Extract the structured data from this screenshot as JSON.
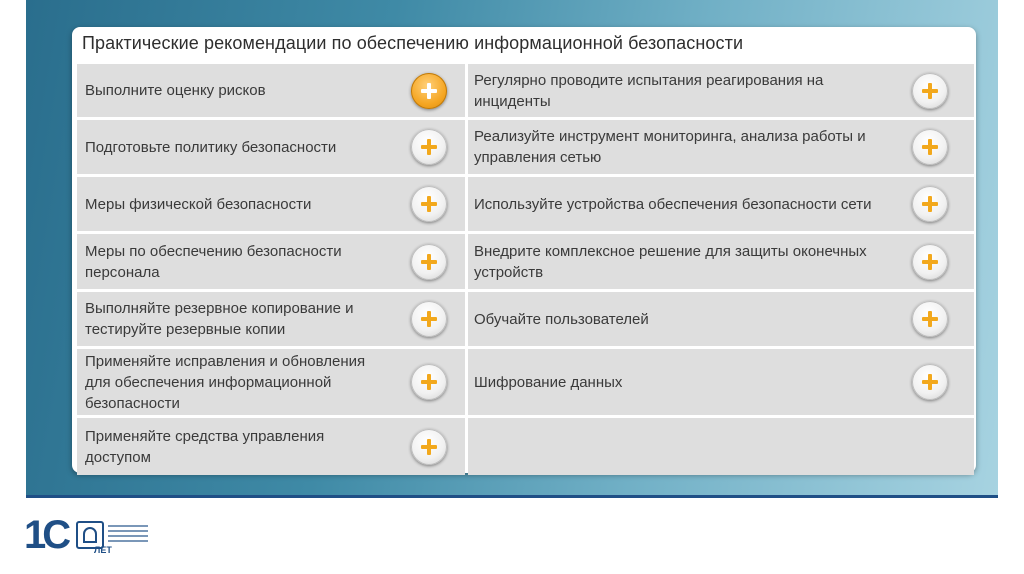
{
  "title": "Практические рекомендации по обеспечению информационной безопасности",
  "left_items": [
    {
      "label": "Выполните оценку рисков",
      "active": true
    },
    {
      "label": "Подготовьте политику безопасности",
      "active": false
    },
    {
      "label": "Меры физической безопасности",
      "active": false
    },
    {
      "label": "Меры по обеспечению безопасности персонала",
      "active": false
    },
    {
      "label": "Выполняйте резервное копирование и тестируйте резервные копии",
      "active": false
    },
    {
      "label": "Применяйте исправления и обновления для обеспечения информационной безопасности",
      "active": false
    },
    {
      "label": "Применяйте средства управления доступом",
      "active": false
    }
  ],
  "right_items": [
    {
      "label": "Регулярно проводите испытания реагирования на инциденты",
      "active": false
    },
    {
      "label": "Реализуйте инструмент мониторинга, анализа работы и управления сетью",
      "active": false
    },
    {
      "label": "Используйте устройства обеспечения безопасности сети",
      "active": false
    },
    {
      "label": "Внедрите комплексное решение для защиты оконечных устройств",
      "active": false
    },
    {
      "label": "Обучайте пользователей",
      "active": false
    },
    {
      "label": "Шифрование данных",
      "active": false
    }
  ],
  "logo": {
    "digits": "1С",
    "years": "ЛЕТ"
  },
  "colors": {
    "accent": "#f5a623",
    "cell": "#dedede",
    "brand": "#1f4f86"
  },
  "icons": {
    "expand": "plus-icon"
  }
}
